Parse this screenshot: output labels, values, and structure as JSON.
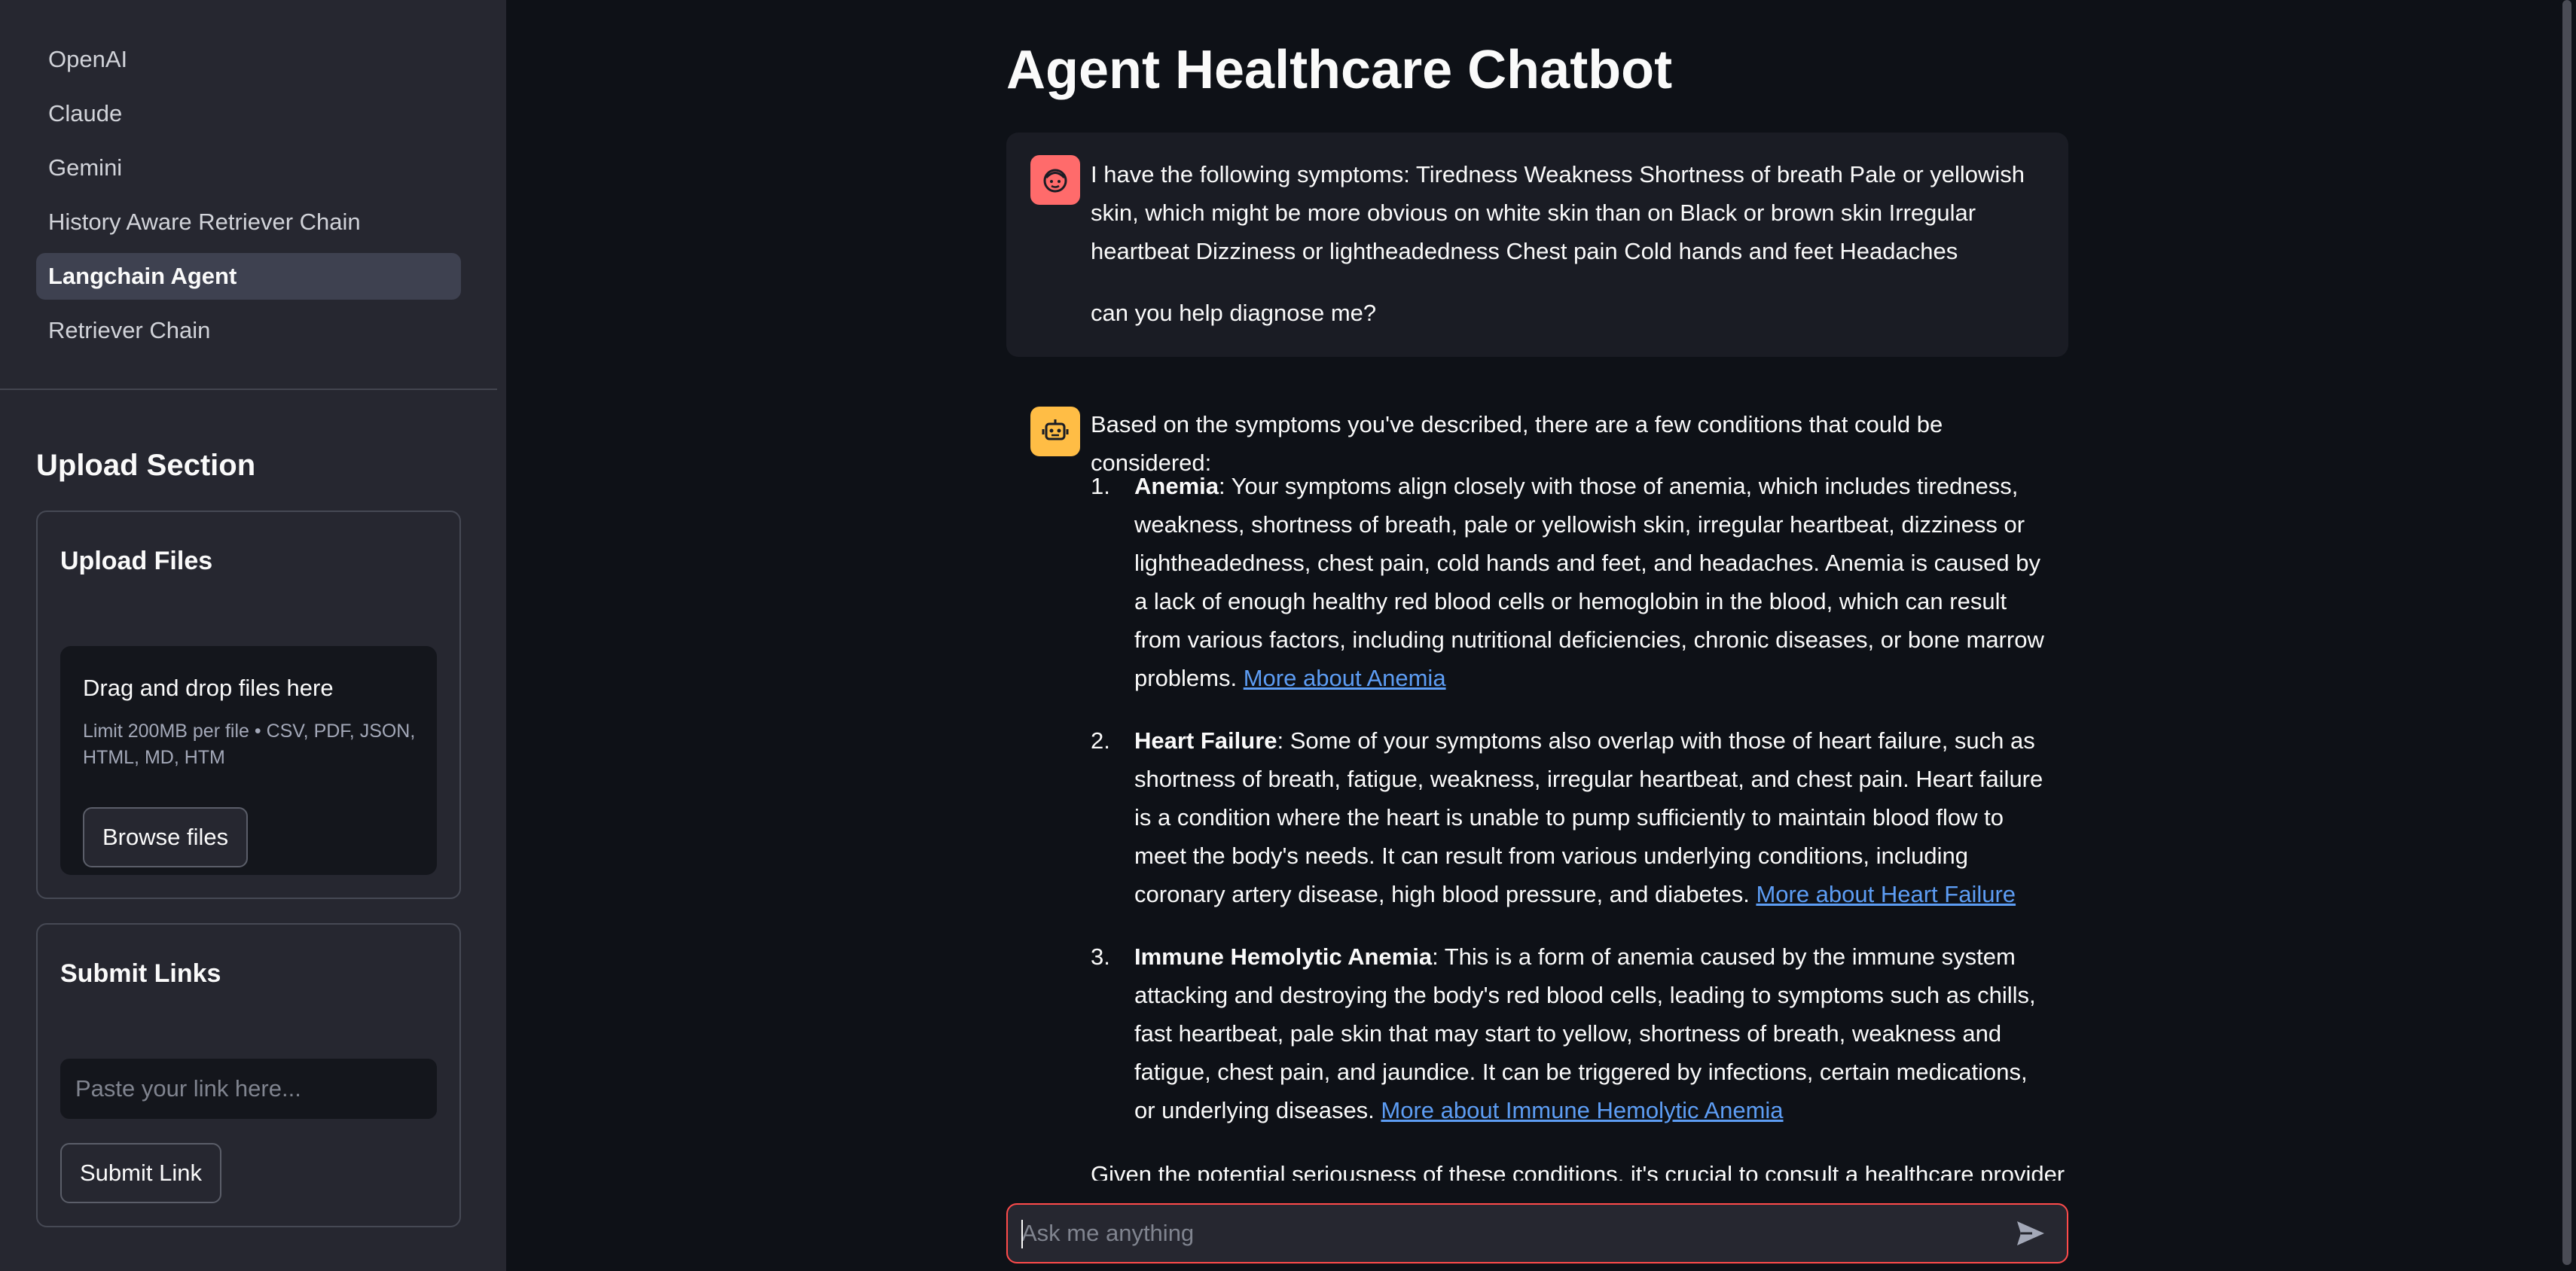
{
  "sidebar": {
    "nav_items": [
      {
        "label": "OpenAI",
        "active": false
      },
      {
        "label": "Claude",
        "active": false
      },
      {
        "label": "Gemini",
        "active": false
      },
      {
        "label": "History Aware Retriever Chain",
        "active": false
      },
      {
        "label": "Langchain Agent",
        "active": true
      },
      {
        "label": "Retriever Chain",
        "active": false
      }
    ],
    "upload_section_title": "Upload Section",
    "upload_files": {
      "title": "Upload Files",
      "dropzone_title": "Drag and drop files here",
      "dropzone_hint": "Limit 200MB per file • CSV, PDF, JSON, HTML, MD, HTM",
      "browse_label": "Browse files"
    },
    "submit_links": {
      "title": "Submit Links",
      "input_placeholder": "Paste your link here...",
      "submit_label": "Submit Link"
    }
  },
  "main": {
    "title": "Agent Healthcare Chatbot",
    "messages": {
      "user": {
        "avatar_icon": "user-face-icon",
        "symptoms": "I have the following symptoms: Tiredness Weakness Shortness of breath Pale or yellowish skin, which might be more obvious on white skin than on Black or brown skin Irregular heartbeat Dizziness or lightheadedness Chest pain Cold hands and feet Headaches",
        "question": "can you help diagnose me?"
      },
      "assistant": {
        "avatar_icon": "robot-icon",
        "intro": "Based on the symptoms you've described, there are a few conditions that could be considered:",
        "items": [
          {
            "num": "1.",
            "name": "Anemia",
            "text": ": Your symptoms align closely with those of anemia, which includes tiredness, weakness, shortness of breath, pale or yellowish skin, irregular heartbeat, dizziness or lightheadedness, chest pain, cold hands and feet, and headaches. Anemia is caused by a lack of enough healthy red blood cells or hemoglobin in the blood, which can result from various factors, including nutritional deficiencies, chronic diseases, or bone marrow problems. ",
            "link": "More about Anemia"
          },
          {
            "num": "2.",
            "name": "Heart Failure",
            "text": ": Some of your symptoms also overlap with those of heart failure, such as shortness of breath, fatigue, weakness, irregular heartbeat, and chest pain. Heart failure is a condition where the heart is unable to pump sufficiently to maintain blood flow to meet the body's needs. It can result from various underlying conditions, including coronary artery disease, high blood pressure, and diabetes. ",
            "link": "More about Heart Failure"
          },
          {
            "num": "3.",
            "name": "Immune Hemolytic Anemia",
            "text": ": This is a form of anemia caused by the immune system attacking and destroying the body's red blood cells, leading to symptoms such as chills, fast heartbeat, pale skin that may start to yellow, shortness of breath, weakness and fatigue, chest pain, and jaundice. It can be triggered by infections, certain medications, or underlying diseases. ",
            "link": "More about Immune Hemolytic Anemia"
          }
        ],
        "outro": "Given the potential seriousness of these conditions, it's crucial to consult a healthcare provider"
      }
    },
    "chat_input": {
      "placeholder": "Ask me anything",
      "send_icon": "send-icon"
    }
  },
  "colors": {
    "accent": "#ff4b4b",
    "link": "#5d9df4",
    "user_avatar": "#ff6b6b",
    "bot_avatar": "#ffbd45"
  }
}
